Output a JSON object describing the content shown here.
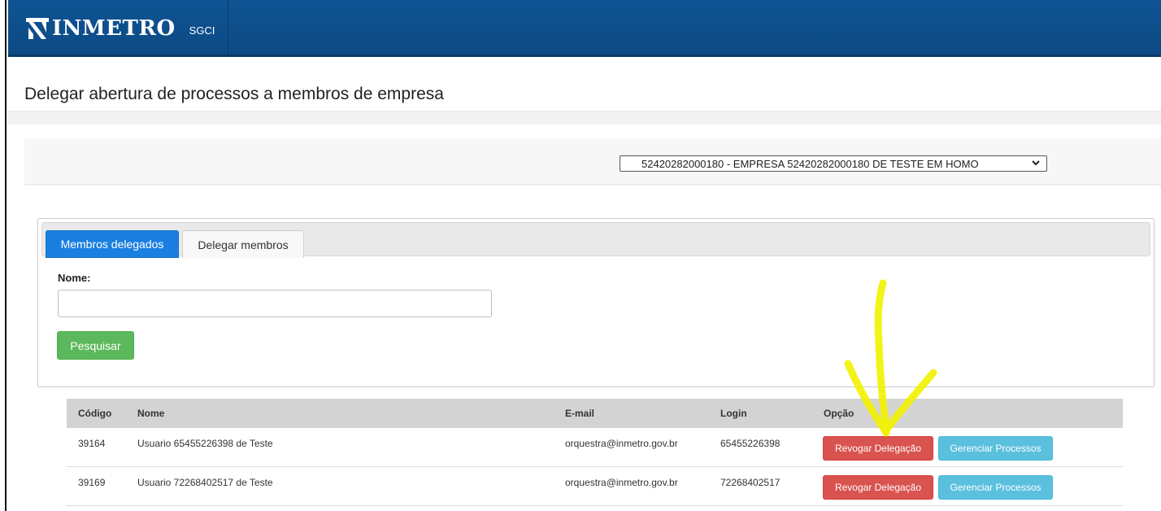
{
  "app": {
    "logo_text": "INMETRO",
    "nav_item": "SGCI"
  },
  "page": {
    "title": "Delegar abertura de processos a membros de empresa"
  },
  "filter": {
    "company_selected": "52420282000180 - EMPRESA 52420282000180 DE TESTE EM HOMO"
  },
  "tabs": [
    {
      "label": "Membros delegados",
      "active": true
    },
    {
      "label": "Delegar membros",
      "active": false
    }
  ],
  "search": {
    "name_label": "Nome:",
    "name_value": "",
    "button_label": "Pesquisar"
  },
  "table": {
    "headers": [
      "Código",
      "Nome",
      "E-mail",
      "Login",
      "Opção"
    ],
    "rows": [
      {
        "codigo": "39164",
        "nome": "Usuario 65455226398 de Teste",
        "email": "orquestra@inmetro.gov.br",
        "login": "65455226398"
      },
      {
        "codigo": "39169",
        "nome": "Usuario 72268402517 de Teste",
        "email": "orquestra@inmetro.gov.br",
        "login": "72268402517"
      }
    ],
    "revoke_label": "Revogar Delegação",
    "manage_label": "Gerenciar Processos"
  },
  "colors": {
    "navbar": "#0f5494",
    "tab_active": "#1a7fe0",
    "search_btn": "#5cb85c",
    "revoke_btn": "#d9534f",
    "manage_btn": "#5bc0de",
    "annotation": "#f5f500"
  },
  "icons": {
    "logo": "inmetro-logo-mark",
    "select": "chevron-down-icon",
    "annotation": "hand-drawn-arrow"
  }
}
